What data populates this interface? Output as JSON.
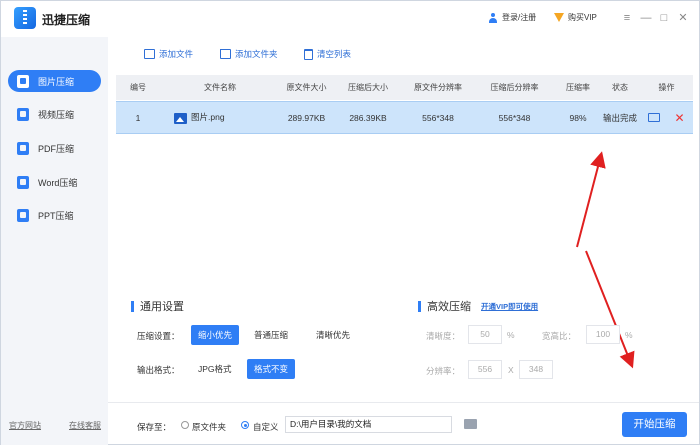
{
  "app": {
    "title": "迅捷压缩",
    "login": "登录/注册",
    "vip": "购买VIP"
  },
  "window_controls": [
    "≡",
    "—",
    "□",
    "✕"
  ],
  "sidebar": {
    "items": [
      {
        "label": "图片压缩",
        "icon": "image-icon",
        "active": true
      },
      {
        "label": "视频压缩",
        "icon": "video-icon",
        "active": false
      },
      {
        "label": "PDF压缩",
        "icon": "pdf-icon",
        "active": false
      },
      {
        "label": "Word压缩",
        "icon": "word-icon",
        "active": false
      },
      {
        "label": "PPT压缩",
        "icon": "ppt-icon",
        "active": false
      }
    ],
    "footer": {
      "website": "官方网站",
      "support": "在线客服"
    }
  },
  "toolbar": {
    "add_file": "添加文件",
    "add_folder": "添加文件夹",
    "clear_list": "清空列表"
  },
  "table": {
    "headers": [
      "编号",
      "文件名称",
      "原文件大小",
      "压缩后大小",
      "原文件分辨率",
      "压缩后分辨率",
      "压缩率",
      "状态",
      "操作"
    ],
    "rows": [
      {
        "index": "1",
        "name": "图片.png",
        "orig_size": "289.97KB",
        "new_size": "286.39KB",
        "orig_res": "556*348",
        "new_res": "556*348",
        "rate": "98%",
        "status": "输出完成"
      }
    ]
  },
  "settings": {
    "general_title": "通用设置",
    "compress_label": "压缩设置：",
    "compress_options": [
      "缩小优先",
      "普通压缩",
      "清晰优先"
    ],
    "compress_selected": "缩小优先",
    "format_label": "输出格式：",
    "format_options": [
      "JPG格式",
      "格式不变"
    ],
    "format_selected": "格式不变",
    "efficient_title": "高效压缩",
    "vip_link": "开通VIP即可使用",
    "clarity_label": "清晰度：",
    "clarity_value": "50",
    "clarity_unit": "%",
    "aspect_label": "宽高比：",
    "aspect_value": "100",
    "aspect_unit": "%",
    "resolution_label": "分辨率：",
    "res_width": "556",
    "res_sep": "X",
    "res_height": "348"
  },
  "output": {
    "save_to": "保存至：",
    "option_original": "原文件夹",
    "option_custom": "自定义",
    "selected": "自定义",
    "path": "D:\\用户目录\\我的文档",
    "start_button": "开始压缩"
  },
  "colors": {
    "accent": "#2f7ef5",
    "row_highlight": "#cde4fb",
    "sidebar_bg": "#f3f5f9",
    "delete": "#e33333",
    "arrow": "#e02020"
  }
}
